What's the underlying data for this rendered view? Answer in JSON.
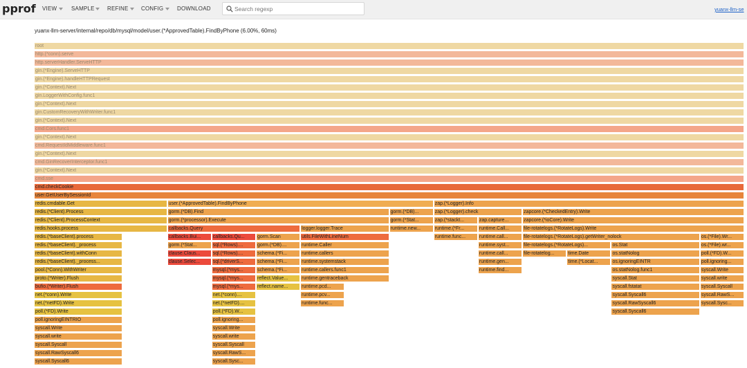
{
  "header": {
    "logo": "pprof",
    "menu": [
      {
        "label": "VIEW",
        "dropdown": true
      },
      {
        "label": "SAMPLE",
        "dropdown": true
      },
      {
        "label": "REFINE",
        "dropdown": true
      },
      {
        "label": "CONFIG",
        "dropdown": true
      },
      {
        "label": "DOWNLOAD",
        "dropdown": false
      }
    ],
    "search_placeholder": "Search regexp",
    "search_value": "",
    "user_link": "yuanx-llm-se"
  },
  "focus_title": "yuanx-llm-server/internal/repo/db/mysql/model/user.(*ApprovedTable).FindByPhone (6.00%, 60ms)",
  "colors": {
    "faded_pale": "#efd8a3",
    "faded_salmon": "#f3b89a",
    "faded_cors": "#f4a68a",
    "highlight_dark": "#e8693a",
    "orange": "#eda34d",
    "orange_light": "#f0ad52",
    "gold": "#e7b744",
    "yellow": "#e6c241",
    "red": "#ec4a3c",
    "red_orange": "#ee6b3e",
    "dark_orange": "#e7853b",
    "orange_mid": "#e89a44"
  },
  "flame": [
    {
      "row": 0,
      "x0": 0,
      "x1": 1,
      "name": "root",
      "c": "faded_pale",
      "faded": true
    },
    {
      "row": 1,
      "x0": 0,
      "x1": 1,
      "name": "http.(*conn).serve",
      "c": "faded_salmon",
      "faded": true
    },
    {
      "row": 2,
      "x0": 0,
      "x1": 1,
      "name": "http.serverHandler.ServeHTTP",
      "c": "faded_salmon",
      "faded": true
    },
    {
      "row": 3,
      "x0": 0,
      "x1": 1,
      "name": "gin.(*Engine).ServeHTTP",
      "c": "faded_pale",
      "faded": true
    },
    {
      "row": 4,
      "x0": 0,
      "x1": 1,
      "name": "gin.(*Engine).handleHTTPRequest",
      "c": "faded_pale",
      "faded": true
    },
    {
      "row": 5,
      "x0": 0,
      "x1": 1,
      "name": "gin.(*Context).Next",
      "c": "faded_pale",
      "faded": true
    },
    {
      "row": 6,
      "x0": 0,
      "x1": 1,
      "name": "gin.LoggerWithConfig.func1",
      "c": "faded_pale",
      "faded": true
    },
    {
      "row": 7,
      "x0": 0,
      "x1": 1,
      "name": "gin.(*Context).Next",
      "c": "faded_pale",
      "faded": true
    },
    {
      "row": 8,
      "x0": 0,
      "x1": 1,
      "name": "gin.CustomRecoveryWithWriter.func1",
      "c": "faded_pale",
      "faded": true
    },
    {
      "row": 9,
      "x0": 0,
      "x1": 1,
      "name": "gin.(*Context).Next",
      "c": "faded_pale",
      "faded": true
    },
    {
      "row": 10,
      "x0": 0,
      "x1": 1,
      "name": "cmd.Cors.func1",
      "c": "faded_cors",
      "faded": true
    },
    {
      "row": 11,
      "x0": 0,
      "x1": 1,
      "name": "gin.(*Context).Next",
      "c": "faded_pale",
      "faded": true
    },
    {
      "row": 12,
      "x0": 0,
      "x1": 1,
      "name": "cmd.RequestIdMiddleware.func1",
      "c": "faded_salmon",
      "faded": true
    },
    {
      "row": 13,
      "x0": 0,
      "x1": 1,
      "name": "gin.(*Context).Next",
      "c": "faded_pale",
      "faded": true
    },
    {
      "row": 14,
      "x0": 0,
      "x1": 1,
      "name": "cmd.GinRecoverInterceptor.func1",
      "c": "faded_salmon",
      "faded": true
    },
    {
      "row": 15,
      "x0": 0,
      "x1": 1,
      "name": "gin.(*Context).Next",
      "c": "faded_pale",
      "faded": true
    },
    {
      "row": 16,
      "x0": 0,
      "x1": 1,
      "name": "cmd.sse",
      "c": "faded_cors",
      "faded": true
    },
    {
      "row": 17,
      "x0": 0,
      "x1": 1,
      "name": "cmd.checkCookie",
      "c": "highlight_dark"
    },
    {
      "row": 18,
      "x0": 0,
      "x1": 1,
      "name": "user.GetUserBySessionId",
      "c": "dark_orange"
    },
    {
      "row": 19,
      "x0": 0,
      "x1": 0.1875,
      "name": "redis.cmdable.Get",
      "c": "gold"
    },
    {
      "row": 19,
      "x0": 0.1875,
      "x1": 0.5625,
      "name": "user.(*ApprovedTable).FindByPhone",
      "c": "orange_light"
    },
    {
      "row": 19,
      "x0": 0.5625,
      "x1": 1,
      "name": "zap.(*Logger).Info",
      "c": "orange"
    },
    {
      "row": 20,
      "x0": 0,
      "x1": 0.1875,
      "name": "redis.(*Client).Process",
      "c": "gold"
    },
    {
      "row": 20,
      "x0": 0.1875,
      "x1": 0.5,
      "name": "gorm.(*DB).Find",
      "c": "orange"
    },
    {
      "row": 20,
      "x0": 0.5,
      "x1": 0.5625,
      "name": "gorm.(*DB)...",
      "c": "orange"
    },
    {
      "row": 20,
      "x0": 0.5625,
      "x1": 0.6875,
      "name": "zap.(*Logger).check",
      "c": "orange"
    },
    {
      "row": 20,
      "x0": 0.6875,
      "x1": 1,
      "name": "zapcore.(*CheckedEntry).Write",
      "c": "orange"
    },
    {
      "row": 21,
      "x0": 0,
      "x1": 0.1875,
      "name": "redis.(*Client).ProcessContext",
      "c": "gold"
    },
    {
      "row": 21,
      "x0": 0.1875,
      "x1": 0.5,
      "name": "gorm.(*processor).Execute",
      "c": "orange"
    },
    {
      "row": 21,
      "x0": 0.5,
      "x1": 0.5625,
      "name": "gorm.(*Stat...",
      "c": "orange"
    },
    {
      "row": 21,
      "x0": 0.5625,
      "x1": 0.625,
      "name": "zap.(*stackt...",
      "c": "orange"
    },
    {
      "row": 21,
      "x0": 0.625,
      "x1": 0.6875,
      "name": "zap.capture...",
      "c": "orange"
    },
    {
      "row": 21,
      "x0": 0.6875,
      "x1": 1,
      "name": "zapcore.(*ioCore).Write",
      "c": "orange"
    },
    {
      "row": 22,
      "x0": 0,
      "x1": 0.1875,
      "name": "redis.hooks.process",
      "c": "gold"
    },
    {
      "row": 22,
      "x0": 0.1875,
      "x1": 0.375,
      "name": "callbacks.Query",
      "c": "red_orange"
    },
    {
      "row": 22,
      "x0": 0.375,
      "x1": 0.5,
      "name": "logger.logger.Trace",
      "c": "orange"
    },
    {
      "row": 22,
      "x0": 0.5,
      "x1": 0.5625,
      "name": "runtime.new...",
      "c": "orange"
    },
    {
      "row": 22,
      "x0": 0.5625,
      "x1": 0.625,
      "name": "runtime.(*Fr...",
      "c": "orange"
    },
    {
      "row": 22,
      "x0": 0.625,
      "x1": 0.6875,
      "name": "runtime.Call...",
      "c": "orange"
    },
    {
      "row": 22,
      "x0": 0.6875,
      "x1": 1,
      "name": "file-rotatelogs.(*RotateLogs).Write",
      "c": "orange"
    },
    {
      "row": 23,
      "x0": 0,
      "x1": 0.125,
      "name": "redis.(*baseClient).process",
      "c": "gold"
    },
    {
      "row": 23,
      "x0": 0.1875,
      "x1": 0.25,
      "name": "callbacks.Bui...",
      "c": "red"
    },
    {
      "row": 23,
      "x0": 0.25,
      "x1": 0.3125,
      "name": "callbacks.Qu...",
      "c": "red"
    },
    {
      "row": 23,
      "x0": 0.3125,
      "x1": 0.375,
      "name": "gorm.Scan",
      "c": "orange"
    },
    {
      "row": 23,
      "x0": 0.375,
      "x1": 0.5,
      "name": "utils.FileWithLineNum",
      "c": "red_orange"
    },
    {
      "row": 23,
      "x0": 0.5625,
      "x1": 0.625,
      "name": "runtime.func...",
      "c": "orange"
    },
    {
      "row": 23,
      "x0": 0.625,
      "x1": 0.6875,
      "name": "runtime.call...",
      "c": "orange"
    },
    {
      "row": 23,
      "x0": 0.6875,
      "x1": 0.9375,
      "name": "file-rotatelogs.(*RotateLogs).getWriter_nolock",
      "c": "orange"
    },
    {
      "row": 23,
      "x0": 0.9375,
      "x1": 1,
      "name": "os.(*File).Wr...",
      "c": "orange"
    },
    {
      "row": 24,
      "x0": 0,
      "x1": 0.125,
      "name": "redis.(*baseClient)._process",
      "c": "gold"
    },
    {
      "row": 24,
      "x0": 0.1875,
      "x1": 0.25,
      "name": "gorm.(*Stat...",
      "c": "orange"
    },
    {
      "row": 24,
      "x0": 0.25,
      "x1": 0.3125,
      "name": "sql.(*Rows)....",
      "c": "red_orange"
    },
    {
      "row": 24,
      "x0": 0.3125,
      "x1": 0.375,
      "name": "gorm.(*DB)....",
      "c": "orange"
    },
    {
      "row": 24,
      "x0": 0.375,
      "x1": 0.5,
      "name": "runtime.Caller",
      "c": "orange"
    },
    {
      "row": 24,
      "x0": 0.625,
      "x1": 0.6875,
      "name": "runtime.syst...",
      "c": "orange"
    },
    {
      "row": 24,
      "x0": 0.6875,
      "x1": 0.8125,
      "name": "file-rotatelogs.(*RotateLogs)...",
      "c": "orange"
    },
    {
      "row": 24,
      "x0": 0.8125,
      "x1": 0.9375,
      "name": "os.Stat",
      "c": "orange"
    },
    {
      "row": 24,
      "x0": 0.9375,
      "x1": 1,
      "name": "os.(*File).wr...",
      "c": "orange"
    },
    {
      "row": 25,
      "x0": 0,
      "x1": 0.125,
      "name": "redis.(*baseClient).withConn",
      "c": "gold"
    },
    {
      "row": 25,
      "x0": 0.1875,
      "x1": 0.25,
      "name": "clause.Claus...",
      "c": "red"
    },
    {
      "row": 25,
      "x0": 0.25,
      "x1": 0.3125,
      "name": "sql.(*Rows)....",
      "c": "red_orange"
    },
    {
      "row": 25,
      "x0": 0.3125,
      "x1": 0.375,
      "name": "schema.(*Fi...",
      "c": "orange"
    },
    {
      "row": 25,
      "x0": 0.375,
      "x1": 0.5,
      "name": "runtime.callers",
      "c": "orange"
    },
    {
      "row": 25,
      "x0": 0.625,
      "x1": 0.6875,
      "name": "runtime.call...",
      "c": "orange"
    },
    {
      "row": 25,
      "x0": 0.6875,
      "x1": 0.75,
      "name": "file-rotatelog...",
      "c": "orange"
    },
    {
      "row": 25,
      "x0": 0.75,
      "x1": 0.8125,
      "name": "time.Date",
      "c": "orange"
    },
    {
      "row": 25,
      "x0": 0.8125,
      "x1": 0.9375,
      "name": "os.statNolog",
      "c": "orange"
    },
    {
      "row": 25,
      "x0": 0.9375,
      "x1": 1,
      "name": "poll.(*FD).W...",
      "c": "orange"
    },
    {
      "row": 26,
      "x0": 0,
      "x1": 0.125,
      "name": "redis.(*baseClient)._process...",
      "c": "gold"
    },
    {
      "row": 26,
      "x0": 0.1875,
      "x1": 0.25,
      "name": "clause.Selec...",
      "c": "red"
    },
    {
      "row": 26,
      "x0": 0.25,
      "x1": 0.3125,
      "name": "sql.(*driverS...",
      "c": "red_orange"
    },
    {
      "row": 26,
      "x0": 0.3125,
      "x1": 0.375,
      "name": "schema.(*Fi...",
      "c": "orange"
    },
    {
      "row": 26,
      "x0": 0.375,
      "x1": 0.5,
      "name": "runtime.systemstack",
      "c": "orange"
    },
    {
      "row": 26,
      "x0": 0.625,
      "x1": 0.6875,
      "name": "runtime.gen...",
      "c": "orange"
    },
    {
      "row": 26,
      "x0": 0.75,
      "x1": 0.8125,
      "name": "time.(*Locat...",
      "c": "orange"
    },
    {
      "row": 26,
      "x0": 0.8125,
      "x1": 0.9375,
      "name": "os.ignoringEINTR",
      "c": "orange"
    },
    {
      "row": 26,
      "x0": 0.9375,
      "x1": 1,
      "name": "poll.ignoring...",
      "c": "orange"
    },
    {
      "row": 27,
      "x0": 0,
      "x1": 0.125,
      "name": "pool.(*Conn).WithWriter",
      "c": "gold"
    },
    {
      "row": 27,
      "x0": 0.25,
      "x1": 0.3125,
      "name": "mysql.(*mys...",
      "c": "red_orange"
    },
    {
      "row": 27,
      "x0": 0.3125,
      "x1": 0.375,
      "name": "schema.(*Fi...",
      "c": "orange"
    },
    {
      "row": 27,
      "x0": 0.375,
      "x1": 0.5,
      "name": "runtime.callers.func1",
      "c": "orange"
    },
    {
      "row": 27,
      "x0": 0.625,
      "x1": 0.6875,
      "name": "runtime.find...",
      "c": "orange"
    },
    {
      "row": 27,
      "x0": 0.8125,
      "x1": 0.9375,
      "name": "os.statNolog.func1",
      "c": "orange"
    },
    {
      "row": 27,
      "x0": 0.9375,
      "x1": 1,
      "name": "syscall.Write",
      "c": "orange"
    },
    {
      "row": 28,
      "x0": 0,
      "x1": 0.125,
      "name": "proto.(*Writer).Flush",
      "c": "gold"
    },
    {
      "row": 28,
      "x0": 0.25,
      "x1": 0.3125,
      "name": "mysql.(*mys...",
      "c": "red_orange"
    },
    {
      "row": 28,
      "x0": 0.3125,
      "x1": 0.375,
      "name": "reflect.Value...",
      "c": "yellow"
    },
    {
      "row": 28,
      "x0": 0.375,
      "x1": 0.5,
      "name": "runtime.gentraceback",
      "c": "orange"
    },
    {
      "row": 28,
      "x0": 0.8125,
      "x1": 0.9375,
      "name": "syscall.Stat",
      "c": "orange"
    },
    {
      "row": 28,
      "x0": 0.9375,
      "x1": 1,
      "name": "syscall.write",
      "c": "orange"
    },
    {
      "row": 29,
      "x0": 0,
      "x1": 0.125,
      "name": "bufio.(*Writer).Flush",
      "c": "red_orange"
    },
    {
      "row": 29,
      "x0": 0.25,
      "x1": 0.3125,
      "name": "mysql.(*mys...",
      "c": "red_orange"
    },
    {
      "row": 29,
      "x0": 0.3125,
      "x1": 0.375,
      "name": "reflect.name...",
      "c": "yellow"
    },
    {
      "row": 29,
      "x0": 0.375,
      "x1": 0.4375,
      "name": "runtime.pcd...",
      "c": "orange"
    },
    {
      "row": 29,
      "x0": 0.8125,
      "x1": 0.9375,
      "name": "syscall.fstatat",
      "c": "orange"
    },
    {
      "row": 29,
      "x0": 0.9375,
      "x1": 1,
      "name": "syscall.Syscall",
      "c": "orange"
    },
    {
      "row": 30,
      "x0": 0,
      "x1": 0.125,
      "name": "net.(*conn).Write",
      "c": "yellow"
    },
    {
      "row": 30,
      "x0": 0.25,
      "x1": 0.3125,
      "name": "net.(*conn)....",
      "c": "yellow"
    },
    {
      "row": 30,
      "x0": 0.375,
      "x1": 0.4375,
      "name": "runtime.pcv...",
      "c": "orange"
    },
    {
      "row": 30,
      "x0": 0.8125,
      "x1": 0.9375,
      "name": "syscall.Syscall6",
      "c": "orange"
    },
    {
      "row": 30,
      "x0": 0.9375,
      "x1": 1,
      "name": "syscall.RawS...",
      "c": "orange"
    },
    {
      "row": 31,
      "x0": 0,
      "x1": 0.125,
      "name": "net.(*netFD).Write",
      "c": "yellow"
    },
    {
      "row": 31,
      "x0": 0.25,
      "x1": 0.3125,
      "name": "net.(*netFD)....",
      "c": "yellow"
    },
    {
      "row": 31,
      "x0": 0.375,
      "x1": 0.4375,
      "name": "runtime.func...",
      "c": "orange"
    },
    {
      "row": 31,
      "x0": 0.8125,
      "x1": 0.9375,
      "name": "syscall.RawSyscall6",
      "c": "orange"
    },
    {
      "row": 31,
      "x0": 0.9375,
      "x1": 1,
      "name": "syscall.Sysc...",
      "c": "orange"
    },
    {
      "row": 32,
      "x0": 0,
      "x1": 0.125,
      "name": "poll.(*FD).Write",
      "c": "yellow"
    },
    {
      "row": 32,
      "x0": 0.25,
      "x1": 0.3125,
      "name": "poll.(*FD).W...",
      "c": "yellow"
    },
    {
      "row": 32,
      "x0": 0.8125,
      "x1": 0.9375,
      "name": "syscall.Syscall6",
      "c": "orange"
    },
    {
      "row": 33,
      "x0": 0,
      "x1": 0.125,
      "name": "poll.ignoringEINTRIO",
      "c": "orange"
    },
    {
      "row": 33,
      "x0": 0.25,
      "x1": 0.3125,
      "name": "poll.ignoring...",
      "c": "orange"
    },
    {
      "row": 34,
      "x0": 0,
      "x1": 0.125,
      "name": "syscall.Write",
      "c": "orange"
    },
    {
      "row": 34,
      "x0": 0.25,
      "x1": 0.3125,
      "name": "syscall.Write",
      "c": "orange"
    },
    {
      "row": 35,
      "x0": 0,
      "x1": 0.125,
      "name": "syscall.write",
      "c": "orange"
    },
    {
      "row": 35,
      "x0": 0.25,
      "x1": 0.3125,
      "name": "syscall.write",
      "c": "orange"
    },
    {
      "row": 36,
      "x0": 0,
      "x1": 0.125,
      "name": "syscall.Syscall",
      "c": "orange"
    },
    {
      "row": 36,
      "x0": 0.25,
      "x1": 0.3125,
      "name": "syscall.Syscall",
      "c": "orange"
    },
    {
      "row": 37,
      "x0": 0,
      "x1": 0.125,
      "name": "syscall.RawSyscall6",
      "c": "orange"
    },
    {
      "row": 37,
      "x0": 0.25,
      "x1": 0.3125,
      "name": "syscall.RawS...",
      "c": "orange"
    },
    {
      "row": 38,
      "x0": 0,
      "x1": 0.125,
      "name": "syscall.Syscall6",
      "c": "orange"
    },
    {
      "row": 38,
      "x0": 0.25,
      "x1": 0.3125,
      "name": "syscall.Sysc...",
      "c": "orange"
    }
  ]
}
